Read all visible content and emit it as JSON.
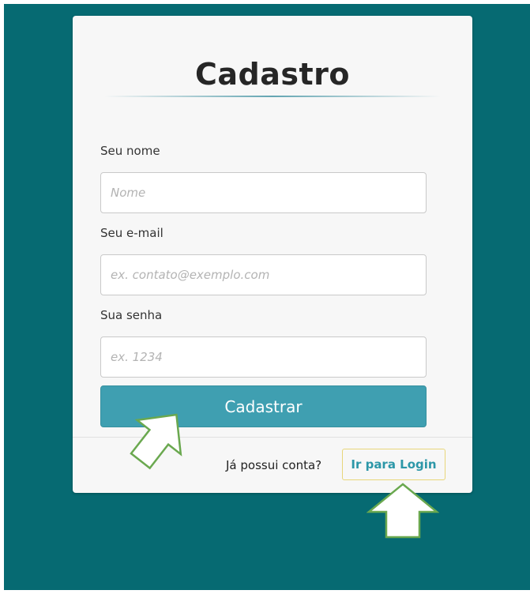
{
  "form": {
    "title": "Cadastro",
    "name_label": "Seu nome",
    "name_placeholder": "Nome",
    "email_label": "Seu e-mail",
    "email_placeholder": "ex. contato@exemplo.com",
    "password_label": "Sua senha",
    "password_placeholder": "ex. 1234",
    "submit_label": "Cadastrar"
  },
  "footer": {
    "question": "Já possui conta?",
    "login_link": "Ir para Login"
  },
  "colors": {
    "backdrop": "#066a72",
    "card": "#f7f7f7",
    "button": "#3f9fb1",
    "link": "#2c97a8",
    "arrow_stroke": "#6aa84f"
  },
  "annotations": {
    "arrow_icon": "up-arrow-icon"
  }
}
